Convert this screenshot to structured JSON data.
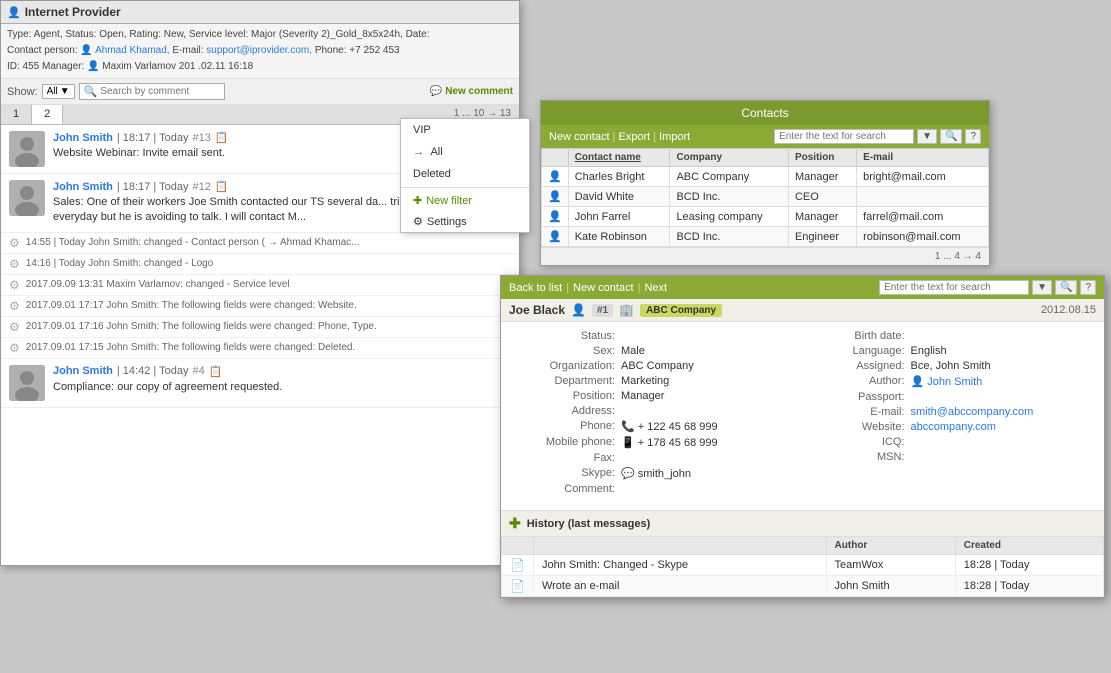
{
  "ticket": {
    "title": "Internet Provider",
    "meta_type": "Type: Agent,",
    "meta_status": "Status: Open,",
    "meta_rating": "Rating: New,",
    "meta_service": "Service level: Major (Severity 2)_Gold_8x5x24h,",
    "meta_date": "Date:",
    "meta_contact": "Contact person:",
    "meta_contact_name": "Ahmad Khamad,",
    "meta_email_label": "E-mail:",
    "meta_email": "support@iprovider.com,",
    "meta_phone": "Phone: +7 252 453",
    "meta_id": "ID: 455",
    "meta_manager": "Manager:",
    "meta_manager_name": "Maxim Varlamov",
    "meta_manager_num": "201",
    "meta_manager_date": ".02.11 16:18",
    "show_label": "Show:",
    "show_value": "All",
    "search_placeholder": "Search by comment",
    "new_comment_label": "New comment",
    "tab1": "1",
    "tab2": "2",
    "pages": "1 ... 10 → 13",
    "messages": [
      {
        "author": "John Smith",
        "time": "18:17",
        "day": "Today",
        "id": "#13",
        "text": "Website Webinar: Invite email sent."
      },
      {
        "author": "John Smith",
        "time": "18:17",
        "day": "Today",
        "id": "#12",
        "text": "Sales: One of their workers Joe Smith contacted our TS several da... tried calling him everyday but he is avoiding to talk. I will contact M..."
      }
    ],
    "system_events": [
      {
        "time": "14:55",
        "day": "Today",
        "text": "John Smith: changed - Contact person ( → Ahmad Khamac..."
      },
      {
        "time": "14:16",
        "day": "Today",
        "text": "John Smith: changed - Logo"
      },
      {
        "date": "2017.09.09 13:31",
        "text": "Maxim Varlamov: changed - Service level"
      },
      {
        "date": "2017.09.01 17:17",
        "text": "John Smith: The following fields were changed: Website."
      },
      {
        "date": "2017.09.01 17:16",
        "text": "John Smith: The following fields were changed: Phone, Type."
      },
      {
        "date": "2017.09.01 17:15",
        "text": "John Smith: The following fields were changed: Deleted."
      }
    ],
    "message3": {
      "author": "John Smith",
      "time": "14:42",
      "day": "Today",
      "id": "#4",
      "text": "Compliance: our copy of agreement requested."
    }
  },
  "filter_dropdown": {
    "items": [
      "VIP",
      "All",
      "Deleted"
    ],
    "active": "All",
    "new_filter": "New filter",
    "settings": "Settings"
  },
  "contacts": {
    "window_title": "Contacts",
    "new_contact": "New contact",
    "export": "Export",
    "import": "Import",
    "search_placeholder": "Enter the text for search",
    "pages": "1 ... 4 → 4",
    "columns": [
      "",
      "Contact name",
      "Company",
      "Position",
      "E-mail"
    ],
    "rows": [
      {
        "name": "Charles Bright",
        "company": "ABC Company",
        "position": "Manager",
        "email": "bright@mail.com"
      },
      {
        "name": "David White",
        "company": "BCD Inc.",
        "position": "CEO",
        "email": ""
      },
      {
        "name": "John Farrel",
        "company": "Leasing company",
        "position": "Manager",
        "email": "farrel@mail.com"
      },
      {
        "name": "Kate Robinson",
        "company": "BCD Inc.",
        "position": "Engineer",
        "email": "robinson@mail.com"
      }
    ]
  },
  "contact_detail": {
    "toolbar": {
      "back_to_list": "Back to list",
      "new_contact": "New contact",
      "next": "Next",
      "search_placeholder": "Enter the text for search"
    },
    "header": {
      "name": "Joe Black",
      "id": "#1",
      "company": "ABC Company",
      "date": "2012.08.15"
    },
    "fields": {
      "status_label": "Status:",
      "status_value": "",
      "sex_label": "Sex:",
      "sex_value": "Male",
      "org_label": "Organization:",
      "org_value": "ABC Company",
      "dept_label": "Department:",
      "dept_value": "Marketing",
      "position_label": "Position:",
      "position_value": "Manager",
      "address_label": "Address:",
      "address_value": "",
      "phone_label": "Phone:",
      "phone_value": "+ 122 45 68 999",
      "mobile_label": "Mobile phone:",
      "mobile_value": "+ 178 45 68 999",
      "fax_label": "Fax:",
      "fax_value": "",
      "skype_label": "Skype:",
      "skype_value": "smith_john",
      "comment_label": "Comment:",
      "comment_value": "",
      "birthdate_label": "Birth date:",
      "birthdate_value": "",
      "language_label": "Language:",
      "language_value": "English",
      "assigned_label": "Assigned:",
      "assigned_value": "Все, John Smith",
      "author_label": "Author:",
      "author_value": "John Smith",
      "passport_label": "Passport:",
      "passport_value": "",
      "email_label": "E-mail:",
      "email_value": "smith@abccompany.com",
      "website_label": "Website:",
      "website_value": "abccompany.com",
      "icq_label": "ICQ:",
      "icq_value": "",
      "msn_label": "MSN:",
      "msn_value": ""
    },
    "history": {
      "title": "History (last messages)",
      "columns": [
        "",
        "Author",
        "Created"
      ],
      "rows": [
        {
          "text": "John Smith: Changed - Skype",
          "author": "TeamWox",
          "created": "18:28 | Today"
        },
        {
          "text": "Wrote an e-mail",
          "author": "John Smith",
          "created": "18:28 | Today"
        }
      ]
    }
  }
}
